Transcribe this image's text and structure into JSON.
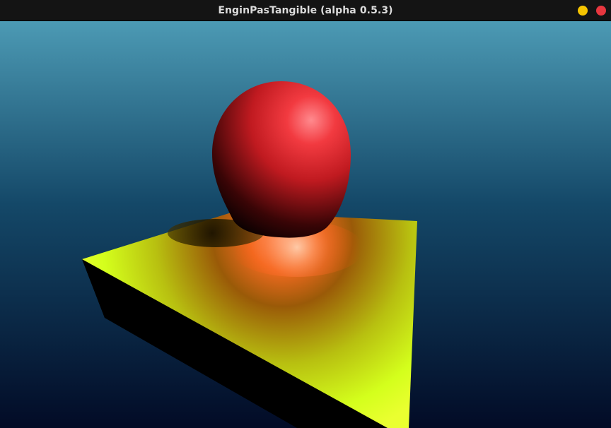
{
  "window": {
    "title": "EnginPasTangible (alpha 0.5.3)",
    "buttons": [
      {
        "name": "minimize",
        "color": "#f5c400"
      },
      {
        "name": "close",
        "color": "#e8373f"
      }
    ]
  },
  "scene": {
    "background_top": "#4c9ab4",
    "background_bottom": "#020b26",
    "objects": [
      {
        "name": "sphere",
        "color": "#e8232d"
      },
      {
        "name": "triangular-prism",
        "color": "#d8ff1a"
      }
    ]
  }
}
